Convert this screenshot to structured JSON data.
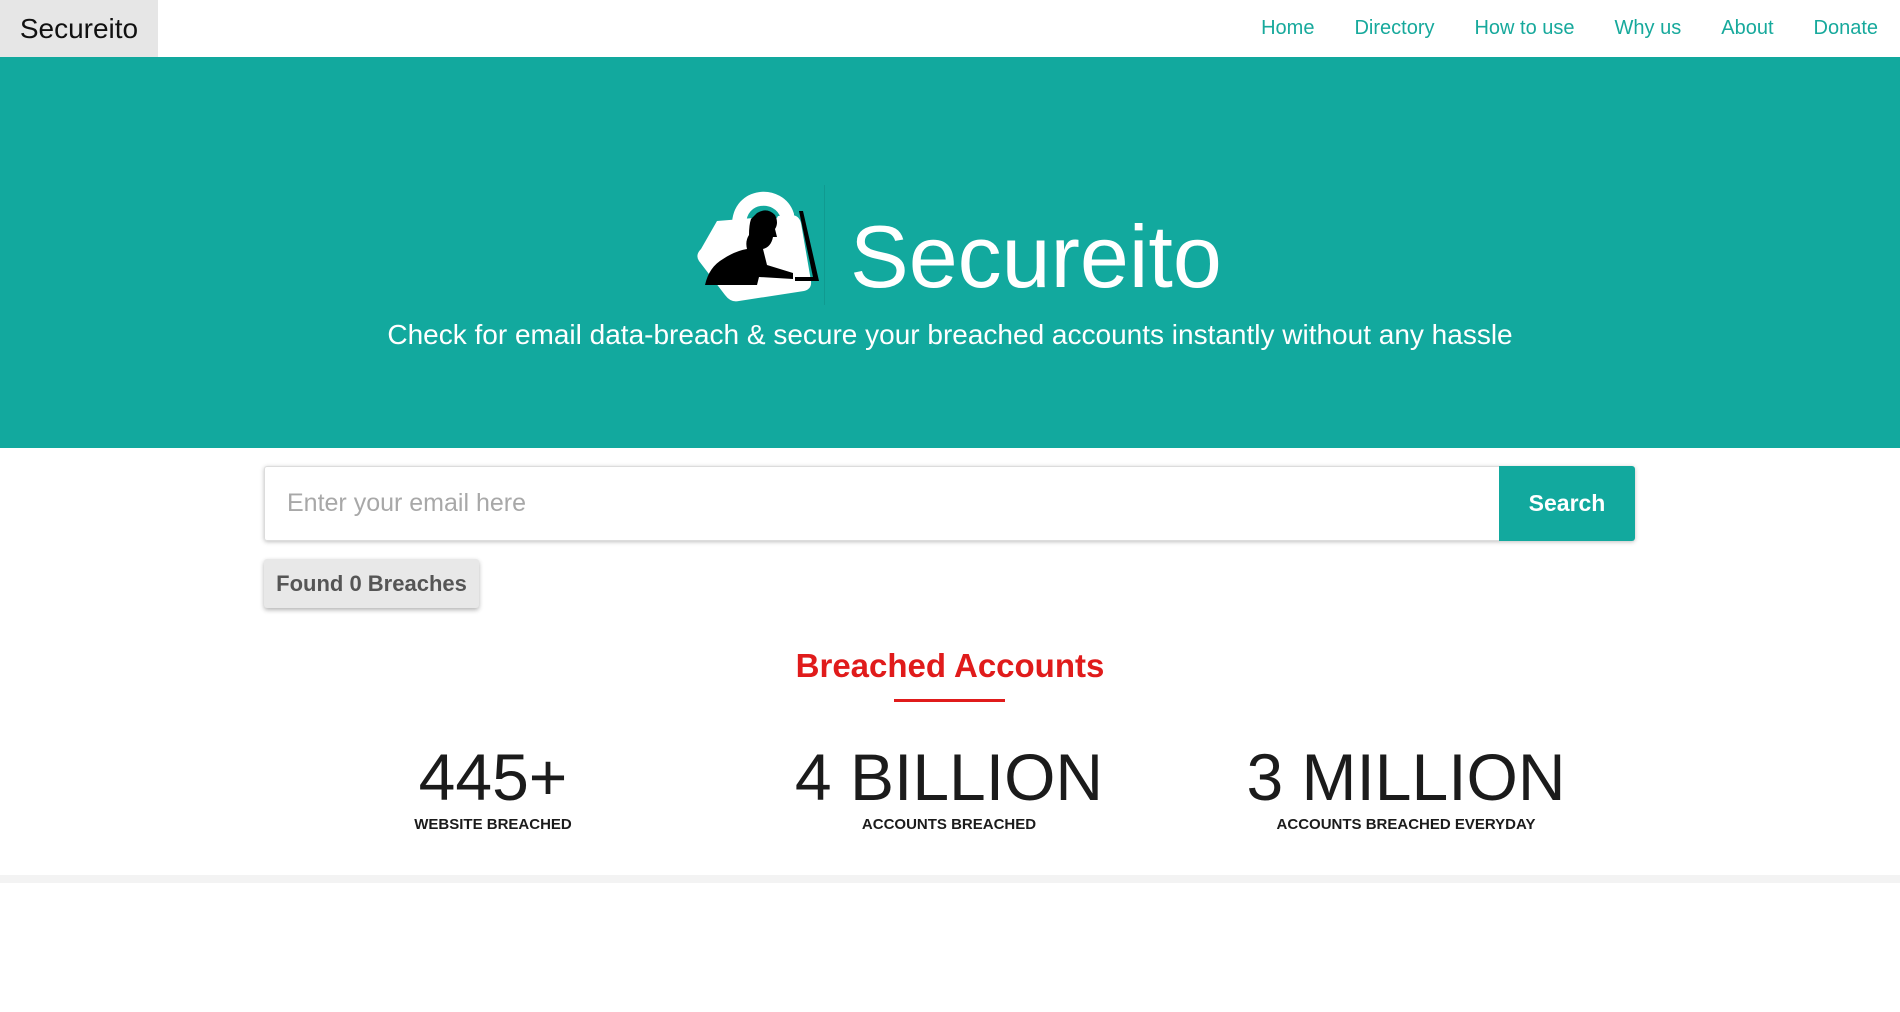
{
  "navbar": {
    "brand": "Secureito",
    "links": [
      "Home",
      "Directory",
      "How to use",
      "Why us",
      "About",
      "Donate"
    ]
  },
  "hero": {
    "logo_icon": "hacker-lock-icon",
    "title": "Secureito",
    "tagline": "Check for email data-breach & secure your breached accounts instantly without any hassle"
  },
  "search": {
    "placeholder": "Enter your email here",
    "value": "",
    "button_label": "Search"
  },
  "results": {
    "badge": "Found 0 Breaches"
  },
  "breached_section": {
    "title": "Breached Accounts",
    "stats": [
      {
        "value": "445+",
        "label": "WEBSITE BREACHED"
      },
      {
        "value": "4 BILLION",
        "label": "ACCOUNTS BREACHED"
      },
      {
        "value": "3 MILLION",
        "label": "ACCOUNTS BREACHED EVERYDAY"
      }
    ]
  },
  "colors": {
    "brand_teal": "#12a99e",
    "nav_link": "#17a99c",
    "accent_red": "#e01b1b",
    "brand_bg": "#e6e6e6"
  }
}
